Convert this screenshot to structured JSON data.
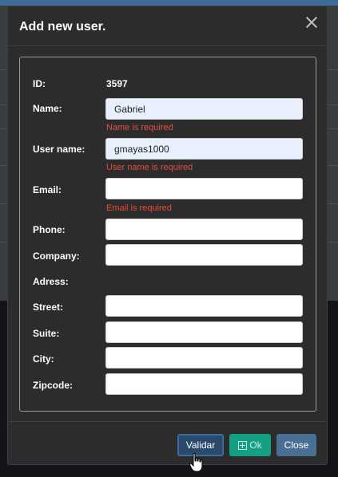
{
  "modal": {
    "title": "Add new user.",
    "fields": {
      "id": {
        "label": "ID:",
        "value": "3597"
      },
      "name": {
        "label": "Name:",
        "value": "Gabriel",
        "error": "Name is required"
      },
      "username": {
        "label": "User name:",
        "value": "gmayas1000",
        "error": "User name is required"
      },
      "email": {
        "label": "Email:",
        "value": "",
        "error": "Email is required"
      },
      "phone": {
        "label": "Phone:",
        "value": ""
      },
      "company": {
        "label": "Company:",
        "value": ""
      },
      "address": {
        "label": "Adress:"
      },
      "street": {
        "label": "Street:",
        "value": ""
      },
      "suite": {
        "label": "Suite:",
        "value": ""
      },
      "city": {
        "label": "City:",
        "value": ""
      },
      "zipcode": {
        "label": "Zipcode:",
        "value": ""
      }
    },
    "footer": {
      "validate_label": "Validar",
      "ok_label": "Ok",
      "close_label": "Close"
    }
  },
  "icons": {
    "close": "close-icon",
    "ok": "plus-square-icon",
    "cursor": "hand-pointer-icon"
  },
  "colors": {
    "accent_blue": "#3d6a96",
    "validate_button": "#2b4a6b",
    "ok_button": "#14a085",
    "close_button": "#4a6f94",
    "error_text": "#e74c3c",
    "modal_background": "#2c2c2c"
  }
}
